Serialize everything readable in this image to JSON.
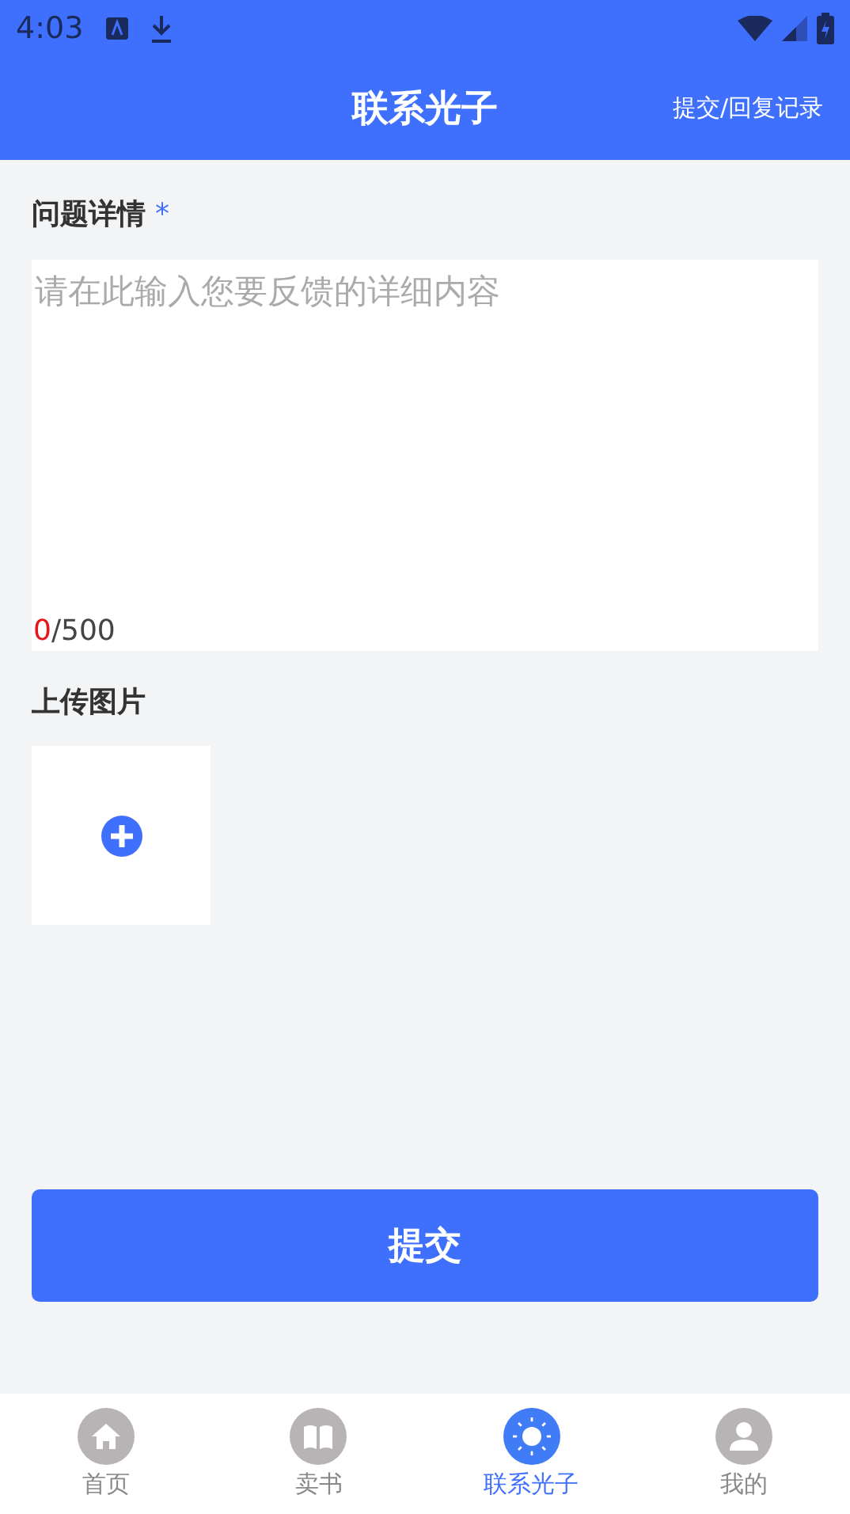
{
  "status_bar": {
    "time": "4:03"
  },
  "header": {
    "title": "联系光子",
    "action": "提交/回复记录"
  },
  "detail": {
    "label": "问题详情",
    "required_mark": "*",
    "placeholder": "请在此输入您要反馈的详细内容",
    "count": "0",
    "limit": "/500"
  },
  "upload": {
    "label": "上传图片"
  },
  "submit": "提交",
  "tabs": [
    {
      "label": "首页",
      "kind": "home",
      "selected": false
    },
    {
      "label": "卖书",
      "kind": "book",
      "selected": false
    },
    {
      "label": "联系光子",
      "kind": "sun",
      "selected": true
    },
    {
      "label": "我的",
      "kind": "person",
      "selected": false
    }
  ]
}
